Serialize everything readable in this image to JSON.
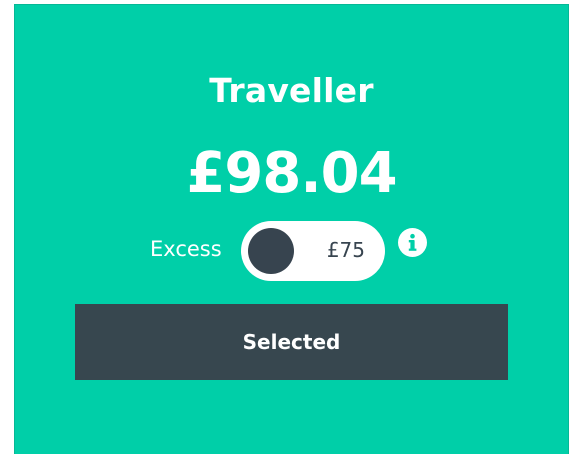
{
  "card": {
    "title": "Traveller",
    "price": "£98.04",
    "excess": {
      "label": "Excess",
      "value": "£75",
      "toggle_on": false
    },
    "info_icon": "info-circle-icon",
    "button_label": "Selected"
  },
  "colors": {
    "card_background": "#00cfa8",
    "button_background": "#37474f",
    "knob": "#37444f",
    "text_light": "#ffffff"
  }
}
